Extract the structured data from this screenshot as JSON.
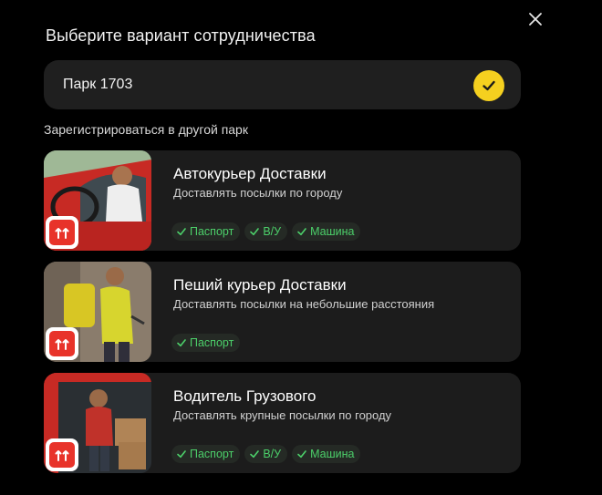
{
  "header": {
    "title": "Выберите вариант сотрудничества",
    "close_icon": "close-icon"
  },
  "current_park": {
    "name": "Парк 1703",
    "selected": true,
    "check_color": "#f5d01f"
  },
  "other_parks_label": "Зарегистрироваться в другой парк",
  "offers": [
    {
      "title": "Автокурьер Доставки",
      "description": "Доставлять посылки по городу",
      "tags": [
        "Паспорт",
        "В/У",
        "Машина"
      ]
    },
    {
      "title": "Пеший курьер Доставки",
      "description": "Доставлять посылки на небольшие расстояния",
      "tags": [
        "Паспорт"
      ]
    },
    {
      "title": "Водитель Грузового",
      "description": "Доставлять крупные посылки по городу",
      "tags": [
        "Паспорт",
        "В/У",
        "Машина"
      ]
    }
  ],
  "colors": {
    "background": "#000000",
    "card": "#1c1c1c",
    "tag_text": "#4cd06a",
    "badge": "#e8332a"
  }
}
